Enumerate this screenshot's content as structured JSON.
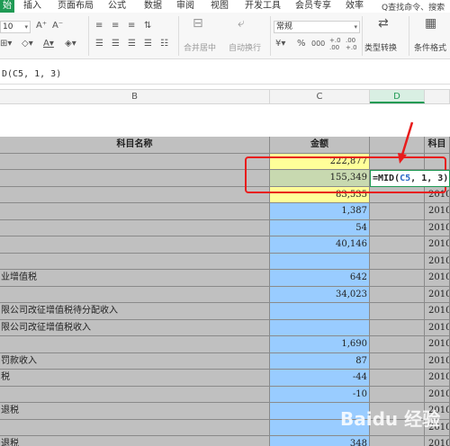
{
  "ribbon_tabs": {
    "home": "始",
    "insert": "插入",
    "layout": "页面布局",
    "formula": "公式",
    "data": "数据",
    "review": "审阅",
    "view": "视图",
    "developer": "开发工具",
    "member": "会员专享",
    "efficiency": "效率",
    "search": "Q查找命令、搜索"
  },
  "ribbon": {
    "font_size": "10",
    "number_format": "常规",
    "merge_center": "合并居中",
    "wrap_text": "自动换行",
    "convert_type": "类型转换",
    "conditional_format": "条件格式",
    "percent": "%",
    "thousands": "000",
    "dec_inc": "+.0 .00",
    "dec_dec": ".00 +.0",
    "currency": "¥"
  },
  "formula_bar": {
    "text": "D(C5, 1, 3)"
  },
  "columns": {
    "b": "B",
    "c": "C",
    "d": "D"
  },
  "header_row": {
    "b": "科目名称",
    "c": "金额",
    "e": "科目"
  },
  "edit_cell": {
    "prefix": "=MID(",
    "ref": "C5",
    "suffix": ", 1, 3)"
  },
  "rows": [
    {
      "b": "",
      "c": "222,877",
      "e": ""
    },
    {
      "b": "",
      "c": "155,349",
      "e": ""
    },
    {
      "b": "",
      "c": "83,535",
      "e": "2010"
    },
    {
      "b": "",
      "c": "1,387",
      "e": "2010"
    },
    {
      "b": "",
      "c": "54",
      "e": "2010"
    },
    {
      "b": "",
      "c": "40,146",
      "e": "2010"
    },
    {
      "b": "",
      "c": "",
      "e": "2010"
    },
    {
      "b": "业增值税",
      "c": "642",
      "e": "2010"
    },
    {
      "b": "",
      "c": "34,023",
      "e": "2010"
    },
    {
      "b": "限公司改征增值税待分配收入",
      "c": "",
      "e": "2010"
    },
    {
      "b": "限公司改征增值税收入",
      "c": "",
      "e": "2010"
    },
    {
      "b": "",
      "c": "1,690",
      "e": "2010"
    },
    {
      "b": "罚款收入",
      "c": "87",
      "e": "2010"
    },
    {
      "b": "税",
      "c": "-44",
      "e": "2010"
    },
    {
      "b": "",
      "c": "-10",
      "e": "2010"
    },
    {
      "b": "退税",
      "c": "",
      "e": "2010"
    },
    {
      "b": "",
      "c": "",
      "e": "2010"
    },
    {
      "b": "退税",
      "c": "348",
      "e": "2010"
    }
  ],
  "watermark": "Baidu 经验",
  "colors": {
    "accent": "#1f9a54",
    "gray_cell": "#c0c0c0",
    "blue_cell": "#99ccff",
    "yellow_cell": "#ffff99",
    "annotation": "#e81c1c"
  }
}
